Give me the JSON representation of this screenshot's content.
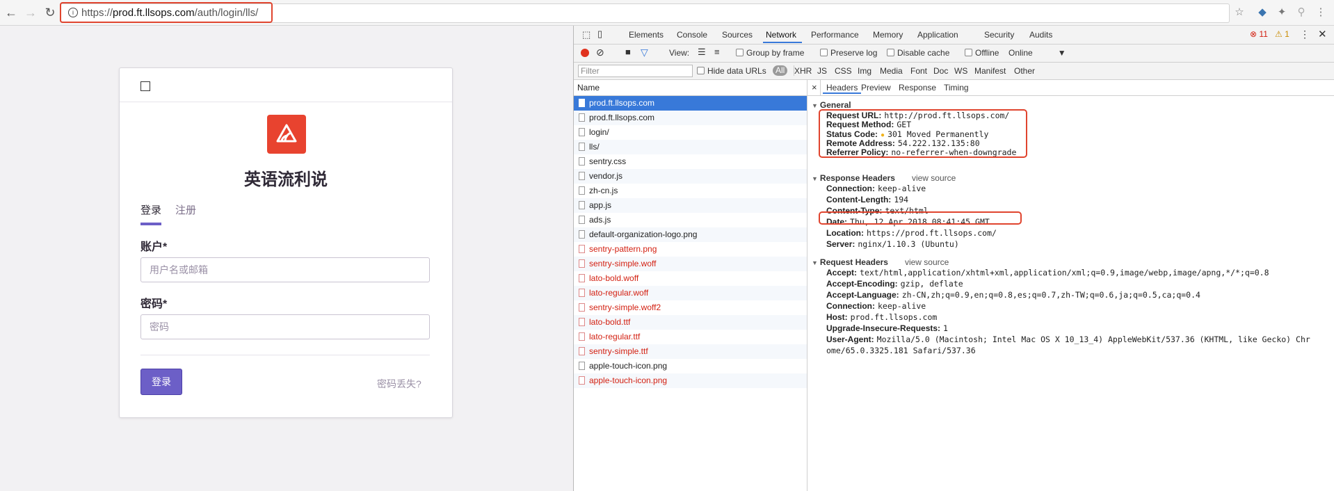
{
  "browser": {
    "url_prefix": "https://",
    "url_host": "prod.ft.llsops.com",
    "url_path": "/auth/login/lls/"
  },
  "login_page": {
    "org_name": "英语流利说",
    "tabs": [
      "登录",
      "注册"
    ],
    "account_label": "账户*",
    "account_placeholder": "用户名或邮箱",
    "password_label": "密码*",
    "password_placeholder": "密码",
    "login_button": "登录",
    "forgot_link": "密码丢失?",
    "brand_color": "#e8432f",
    "accent_color": "#6c5fc7"
  },
  "devtools": {
    "panels": [
      "Elements",
      "Console",
      "Sources",
      "Network",
      "Performance",
      "Memory",
      "Application",
      "Security",
      "Audits"
    ],
    "active_panel": "Network",
    "error_count": "11",
    "warning_count": "1",
    "toolbar": {
      "view_label": "View:",
      "group_by_frame": "Group by frame",
      "preserve_log": "Preserve log",
      "disable_cache": "Disable cache",
      "offline": "Offline",
      "throttle": "Online"
    },
    "filter": {
      "placeholder": "Filter",
      "hide_data_urls": "Hide data URLs",
      "types": [
        "All",
        "XHR",
        "JS",
        "CSS",
        "Img",
        "Media",
        "Font",
        "Doc",
        "WS",
        "Manifest",
        "Other"
      ]
    },
    "network_list": {
      "header": "Name",
      "rows": [
        {
          "name": "prod.ft.llsops.com",
          "state": "selected"
        },
        {
          "name": "prod.ft.llsops.com",
          "state": "normal"
        },
        {
          "name": "login/",
          "state": "normal"
        },
        {
          "name": "lls/",
          "state": "normal"
        },
        {
          "name": "sentry.css",
          "state": "normal"
        },
        {
          "name": "vendor.js",
          "state": "normal"
        },
        {
          "name": "zh-cn.js",
          "state": "normal"
        },
        {
          "name": "app.js",
          "state": "normal"
        },
        {
          "name": "ads.js",
          "state": "normal"
        },
        {
          "name": "default-organization-logo.png",
          "state": "normal"
        },
        {
          "name": "sentry-pattern.png",
          "state": "error"
        },
        {
          "name": "sentry-simple.woff",
          "state": "error"
        },
        {
          "name": "lato-bold.woff",
          "state": "error"
        },
        {
          "name": "lato-regular.woff",
          "state": "error"
        },
        {
          "name": "sentry-simple.woff2",
          "state": "error"
        },
        {
          "name": "lato-bold.ttf",
          "state": "error"
        },
        {
          "name": "lato-regular.ttf",
          "state": "error"
        },
        {
          "name": "sentry-simple.ttf",
          "state": "error"
        },
        {
          "name": "apple-touch-icon.png",
          "state": "normal"
        },
        {
          "name": "apple-touch-icon.png",
          "state": "error"
        }
      ]
    },
    "details": {
      "close": "×",
      "tabs": [
        "Headers",
        "Preview",
        "Response",
        "Timing"
      ],
      "view_source": "view source",
      "general_title": "General",
      "general": [
        {
          "k": "Request URL:",
          "v": "http://prod.ft.llsops.com/"
        },
        {
          "k": "Request Method:",
          "v": "GET"
        },
        {
          "k": "Status Code:",
          "v": "301 Moved Permanently"
        },
        {
          "k": "Remote Address:",
          "v": "54.222.132.135:80"
        },
        {
          "k": "Referrer Policy:",
          "v": "no-referrer-when-downgrade"
        }
      ],
      "response_title": "Response Headers",
      "response": [
        {
          "k": "Connection:",
          "v": "keep-alive"
        },
        {
          "k": "Content-Length:",
          "v": "194"
        },
        {
          "k": "Content-Type:",
          "v": "text/html"
        },
        {
          "k": "Date:",
          "v": "Thu, 12 Apr 2018 08:41:45 GMT"
        },
        {
          "k": "Location:",
          "v": "https://prod.ft.llsops.com/"
        },
        {
          "k": "Server:",
          "v": "nginx/1.10.3 (Ubuntu)"
        }
      ],
      "request_title": "Request Headers",
      "request": [
        {
          "k": "Accept:",
          "v": "text/html,application/xhtml+xml,application/xml;q=0.9,image/webp,image/apng,*/*;q=0.8"
        },
        {
          "k": "Accept-Encoding:",
          "v": "gzip, deflate"
        },
        {
          "k": "Accept-Language:",
          "v": "zh-CN,zh;q=0.9,en;q=0.8,es;q=0.7,zh-TW;q=0.6,ja;q=0.5,ca;q=0.4"
        },
        {
          "k": "Connection:",
          "v": "keep-alive"
        },
        {
          "k": "Host:",
          "v": "prod.ft.llsops.com"
        },
        {
          "k": "Upgrade-Insecure-Requests:",
          "v": "1"
        },
        {
          "k": "User-Agent:",
          "v": "Mozilla/5.0 (Macintosh; Intel Mac OS X 10_13_4) AppleWebKit/537.36 (KHTML, like Gecko) Chr"
        },
        {
          "k": "",
          "v": "ome/65.0.3325.181 Safari/537.36"
        }
      ]
    }
  }
}
